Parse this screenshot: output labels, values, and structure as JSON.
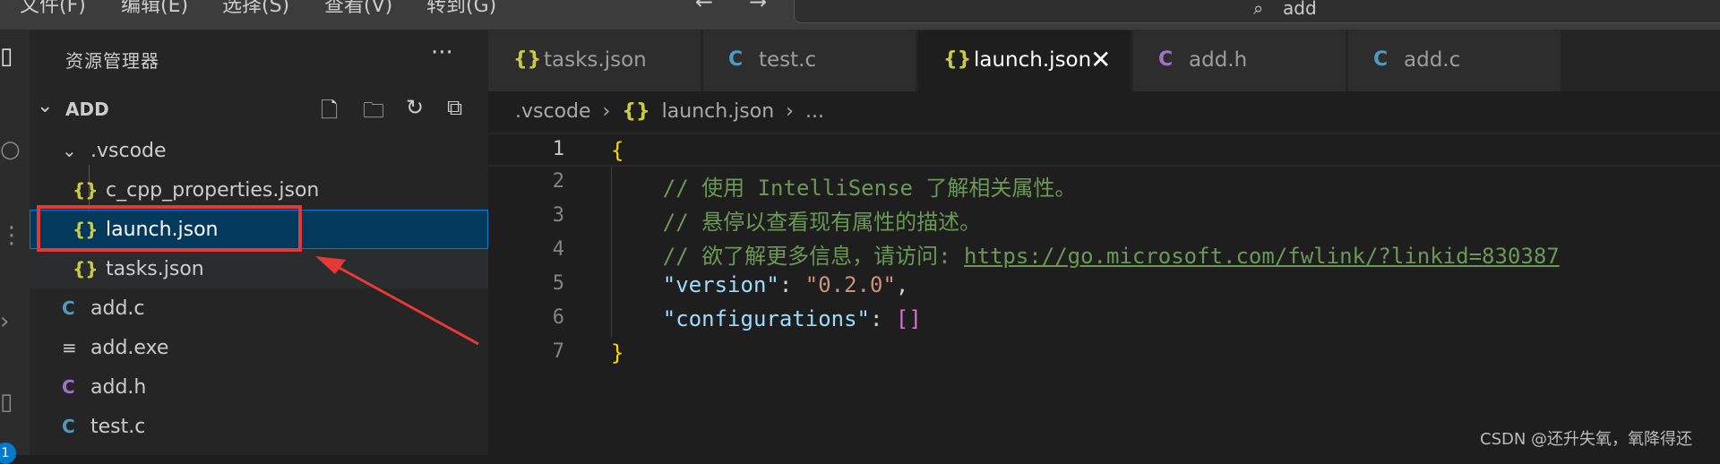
{
  "menu": {
    "items": [
      "文件(F)",
      "编辑(E)",
      "选择(S)",
      "查看(V)",
      "转到(G)"
    ],
    "back_icon": "arrow-left-icon",
    "forward_icon": "arrow-right-icon"
  },
  "command_center": {
    "text": "add",
    "icon": "search-icon"
  },
  "activity_bar": {
    "badge": "1"
  },
  "sidebar": {
    "title": "资源管理器",
    "more": "···",
    "folder": "ADD",
    "tree": [
      {
        "label": ".vscode",
        "icon": "chevron-down-icon",
        "glyph": "⌄"
      },
      {
        "label": "c_cpp_properties.json",
        "icon": "json-icon",
        "glyph": "{}"
      },
      {
        "label": "launch.json",
        "icon": "json-icon",
        "glyph": "{}"
      },
      {
        "label": "tasks.json",
        "icon": "json-icon",
        "glyph": "{}"
      },
      {
        "label": "add.c",
        "icon": "c-file-icon",
        "glyph": "C"
      },
      {
        "label": "add.exe",
        "icon": "file-lines-icon",
        "glyph": "≡"
      },
      {
        "label": "add.h",
        "icon": "c-header-icon",
        "glyph": "C"
      },
      {
        "label": "test.c",
        "icon": "c-file-icon",
        "glyph": "C"
      }
    ]
  },
  "tabs": [
    {
      "label": "tasks.json",
      "glyph": "{}"
    },
    {
      "label": "test.c",
      "glyph": "C"
    },
    {
      "label": "launch.json",
      "glyph": "{}",
      "close": "✕"
    },
    {
      "label": "add.h",
      "glyph": "C"
    },
    {
      "label": "add.c",
      "glyph": "C"
    }
  ],
  "breadcrumb": {
    "folder": ".vscode",
    "sep": "›",
    "glyph": "{}",
    "file": "launch.json",
    "more": "..."
  },
  "editor": {
    "lines": [
      {
        "num": "1",
        "brace": "{"
      },
      {
        "num": "2",
        "comment": "// 使用 IntelliSense 了解相关属性。"
      },
      {
        "num": "3",
        "comment": "// 悬停以查看现有属性的描述。"
      },
      {
        "num": "4",
        "comment": "// 欲了解更多信息，请访问: ",
        "link": "https://go.microsoft.com/fwlink/?linkid=830387"
      },
      {
        "num": "5",
        "key": "version",
        "value": "0.2.0"
      },
      {
        "num": "6",
        "key": "configurations",
        "bracket": "[]"
      },
      {
        "num": "7",
        "brace": "}"
      }
    ]
  },
  "watermark": "CSDN @还升失氧，氧降得还",
  "colors": {
    "accent": "#007acc",
    "annotation": "#e53935",
    "json": "#cbcb41",
    "c": "#519aba",
    "h": "#a074c4"
  }
}
